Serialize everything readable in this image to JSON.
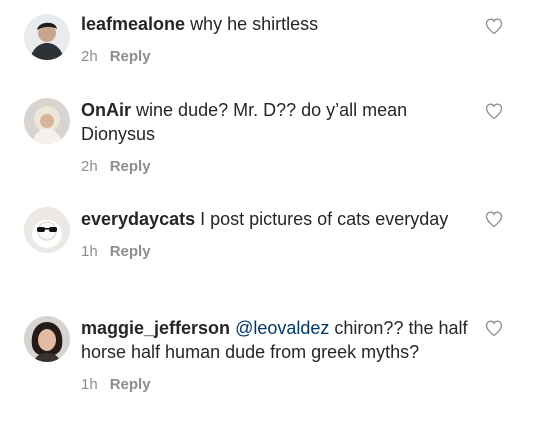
{
  "comments": [
    {
      "username": "leafmealone",
      "mention": "",
      "text": "why he shirtless",
      "time": "2h",
      "reply_label": "Reply",
      "avatar_icon": "avatar-photo-icon"
    },
    {
      "username": "OnAir",
      "mention": "",
      "text": "wine dude? Mr. D?? do y’all mean Dionysus",
      "time": "2h",
      "reply_label": "Reply",
      "avatar_icon": "avatar-photo-icon"
    },
    {
      "username": "everydaycats",
      "mention": "",
      "text": "I post pictures of cats everyday",
      "time": "1h",
      "reply_label": "Reply",
      "avatar_icon": "avatar-photo-icon"
    },
    {
      "username": "maggie_jefferson",
      "mention": "@leovaldez",
      "text": "chiron?? the half horse half human dude from greek myths?",
      "time": "1h",
      "reply_label": "Reply",
      "avatar_icon": "avatar-photo-icon"
    }
  ],
  "icons": {
    "like": "heart-outline-icon"
  },
  "colors": {
    "text": "#262626",
    "meta": "#8e8e8e",
    "mention": "#00376b"
  }
}
